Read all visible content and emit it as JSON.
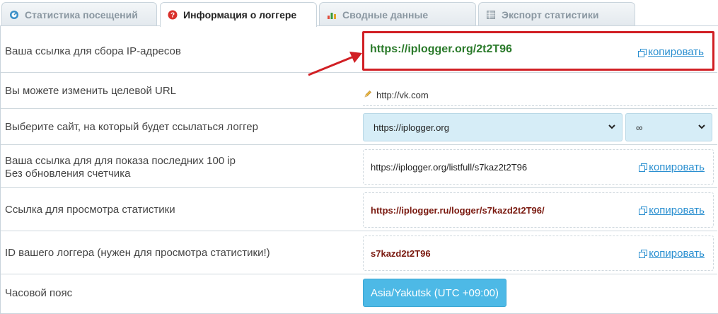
{
  "tabs": [
    {
      "label": "Статистика посещений",
      "icon": "stats-gauge-icon",
      "active": false
    },
    {
      "label": "Информация о логгере",
      "icon": "question-circle-icon",
      "active": true
    },
    {
      "label": "Сводные данные",
      "icon": "bar-chart-icon",
      "active": false
    },
    {
      "label": "Экспорт статистики",
      "icon": "export-sheet-icon",
      "active": false
    }
  ],
  "rows": {
    "ip_link": {
      "label": "Ваша ссылка для сбора IP-адресов",
      "value": "https://iplogger.org/2t2T96",
      "copy": "копировать"
    },
    "target_url": {
      "label": "Вы можете изменить целевой URL",
      "value": "http://vk.com"
    },
    "site": {
      "label": "Выберите сайт, на который будет ссылаться логгер",
      "selected": "https://iplogger.org",
      "second_selected": "∞"
    },
    "last100": {
      "label_line1": "Ваша ссылка для для показа последних 100 ip",
      "label_line2": "Без обновления счетчика",
      "value": "https://iplogger.org/listfull/s7kaz2t2T96",
      "copy": "копировать"
    },
    "stats_link": {
      "label": "Ссылка для просмотра статистики",
      "value": "https://iplogger.ru/logger/s7kazd2t2T96/",
      "copy": "копировать"
    },
    "logger_id": {
      "label": "ID вашего логгера (нужен для просмотра статистики!)",
      "value": "s7kazd2t2T96",
      "copy": "копировать"
    },
    "timezone": {
      "label": "Часовой пояс",
      "value": "Asia/Yakutsk (UTC +09:00)"
    }
  },
  "colors": {
    "accent_blue": "#2a8fd0",
    "highlight_red": "#d11f24",
    "link_green": "#2a7a2a",
    "timezone_button": "#4db9e6"
  }
}
